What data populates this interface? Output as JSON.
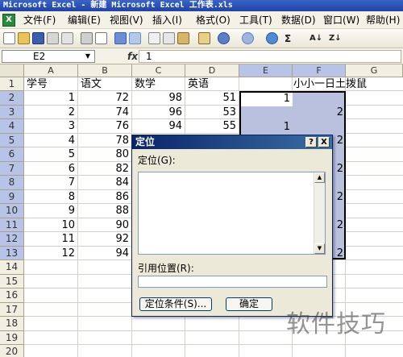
{
  "window": {
    "title": "Microsoft Excel - 新建 Microsoft Excel 工作表.xls"
  },
  "menubar": {
    "icon": "excel-icon",
    "items": [
      "文件(F)",
      "编辑(E)",
      "视图(V)",
      "插入(I)",
      "格式(O)",
      "工具(T)",
      "数据(D)",
      "窗口(W)",
      "帮助(H)"
    ]
  },
  "toolbar": {
    "icons": [
      "new-icon",
      "open-icon",
      "save-icon",
      "permission-icon",
      "email-icon",
      "print-icon",
      "print-preview-icon",
      "spelling-icon",
      "research-icon",
      "cut-icon",
      "copy-icon",
      "paste-icon",
      "format-painter-icon",
      "undo-icon",
      "redo-icon",
      "hyperlink-icon",
      "autosum-icon",
      "sort-ascending-icon",
      "sort-descending-icon"
    ],
    "sum_label": "Σ",
    "sort_asc_label": "A↓",
    "sort_desc_label": "Z↓"
  },
  "formula_bar": {
    "name_box": "E2",
    "fx_label": "fx",
    "value": "1"
  },
  "sheet": {
    "columns": [
      "A",
      "B",
      "C",
      "D",
      "E",
      "F",
      "G"
    ],
    "rows": [
      "1",
      "2",
      "3",
      "4",
      "5",
      "6",
      "7",
      "8",
      "9",
      "10",
      "11",
      "12",
      "13",
      "14",
      "15",
      "16",
      "17",
      "18",
      "19",
      "20"
    ],
    "headers": {
      "A1": "学号",
      "B1": "语文",
      "C1": "数学",
      "D1": "英语",
      "F1": "小小一日土拨鼠"
    },
    "col_a": [
      "1",
      "2",
      "3",
      "4",
      "5",
      "6",
      "7",
      "8",
      "9",
      "10",
      "11",
      "12"
    ],
    "col_b": [
      "72",
      "74",
      "76",
      "78",
      "80",
      "82",
      "84",
      "86",
      "88",
      "90",
      "92",
      "94"
    ],
    "col_c": [
      "98",
      "96",
      "94"
    ],
    "col_d": [
      "51",
      "53",
      "55"
    ],
    "col_e_visible": {
      "E2": "1",
      "E4": "1"
    },
    "col_f_visible": {
      "F3": "2",
      "F5": "2",
      "F7": "2",
      "F9": "2",
      "F11": "2",
      "F13": "2"
    },
    "selection_range": "E2:F13",
    "active_cell": "E2"
  },
  "dialog": {
    "title": "定位",
    "help_label": "?",
    "close_label": "X",
    "goto_label": "定位(G):",
    "reference_label": "引用位置(R):",
    "reference_value": "",
    "special_button": "定位条件(S)...",
    "ok_button": "确定"
  },
  "watermark": "软件技巧"
}
